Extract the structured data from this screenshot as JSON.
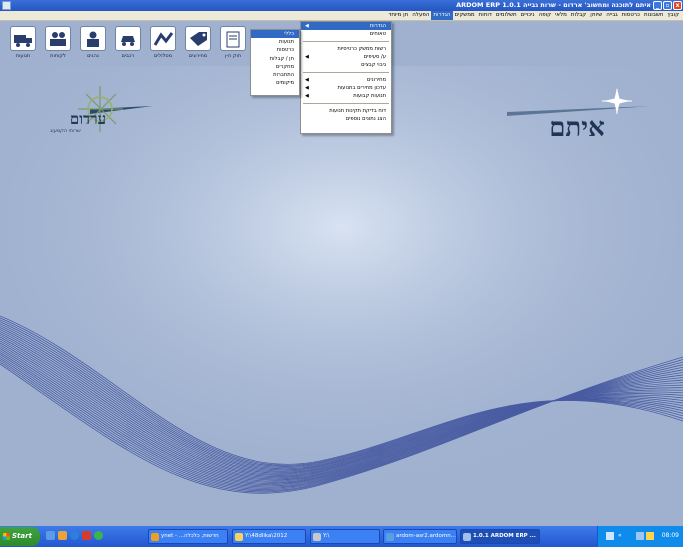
{
  "window": {
    "title": "ARDOM ERP 1.0.1 איתם לתוכנה ומחשוב' ארדום - שרות גבייה",
    "minimize_label": "_",
    "maximize_label": "▫",
    "close_label": "x"
  },
  "menubar": {
    "items": [
      "קובץ",
      "חשבונות",
      "כרטסות",
      "גבייה",
      "שיווק",
      "קבלות",
      "מלאי",
      "קופה",
      "ניכויים",
      "תשלומים",
      "דוחות",
      "ממשקים",
      "הגדרות",
      "הפעלה",
      "חן מיוחד"
    ],
    "active_index": 12
  },
  "toolbar": {
    "items": [
      {
        "label": "חוק ח-ן",
        "icon": "document-icon"
      },
      {
        "label": "מחירונים",
        "icon": "price-tag-icon"
      },
      {
        "label": "מסלולים",
        "icon": "route-icon"
      },
      {
        "label": "רכבים",
        "icon": "car-icon"
      },
      {
        "label": "נהגים",
        "icon": "driver-icon"
      },
      {
        "label": "לקוחות",
        "icon": "customers-icon"
      },
      {
        "label": "תנועות",
        "icon": "truck-icon"
      }
    ]
  },
  "menu_main": {
    "items": [
      {
        "label": "הגדרות",
        "arrow": "◀",
        "active": true
      },
      {
        "label": "טאוחים",
        "arrow": "",
        "active": false
      },
      {
        "sep": true
      },
      {
        "label": "רשות ממשק כרטיסיות",
        "arrow": "",
        "active": false
      },
      {
        "label": "ע/ סעיפים",
        "arrow": "◀",
        "active": false
      },
      {
        "label": "גיבוי קבצים",
        "arrow": "",
        "active": false
      },
      {
        "sep": true
      },
      {
        "label": "מחירונים",
        "arrow": "◀",
        "active": false
      },
      {
        "label": "עדכון מחירים בתנועות",
        "arrow": "◀",
        "active": false
      },
      {
        "label": "תנועות קבועות",
        "arrow": "◀",
        "active": false
      },
      {
        "sep": true
      },
      {
        "label": "דוח בדיקת תקינות תנועות",
        "arrow": "",
        "active": false
      },
      {
        "label": "הצג נתונים נוספים",
        "arrow": "",
        "active": false
      }
    ]
  },
  "menu_sub": {
    "items": [
      {
        "label": "כללי",
        "active": true
      },
      {
        "label": "תנועות",
        "active": false
      },
      {
        "label": "כרטסות",
        "active": false
      },
      {
        "label": "חן / קבלות",
        "active": false
      },
      {
        "label": "מחקרים",
        "active": false
      },
      {
        "label": "התחברות",
        "active": false
      },
      {
        "label": "מיקומים",
        "active": false
      }
    ]
  },
  "logos": {
    "left_name": "ערדום",
    "left_tagline": "שרותי הקמעונ",
    "right_name": "איתם"
  },
  "taskbar": {
    "start_label": "Start",
    "tasks": [
      {
        "label": "ynet - ...חדשות, כלכלה",
        "icon_color": "#f0a020"
      },
      {
        "label": "Y:\\48dlika\\2012",
        "icon_color": "#f4d35e"
      },
      {
        "label": "Y:\\",
        "icon_color": "#c8c8c8"
      },
      {
        "label": "ardom-asr2.ardomn...",
        "icon_color": "#5aa0e0"
      },
      {
        "label": "1.0.1 ARDOM ERP ...",
        "icon_color": "#9fc0ea",
        "active": true
      }
    ],
    "clock": "08:09"
  },
  "colors": {
    "titlebar": "#2456c2",
    "menu_highlight": "#316ac5",
    "background": "#9fb1cf",
    "taskbar": "#2356d1"
  }
}
